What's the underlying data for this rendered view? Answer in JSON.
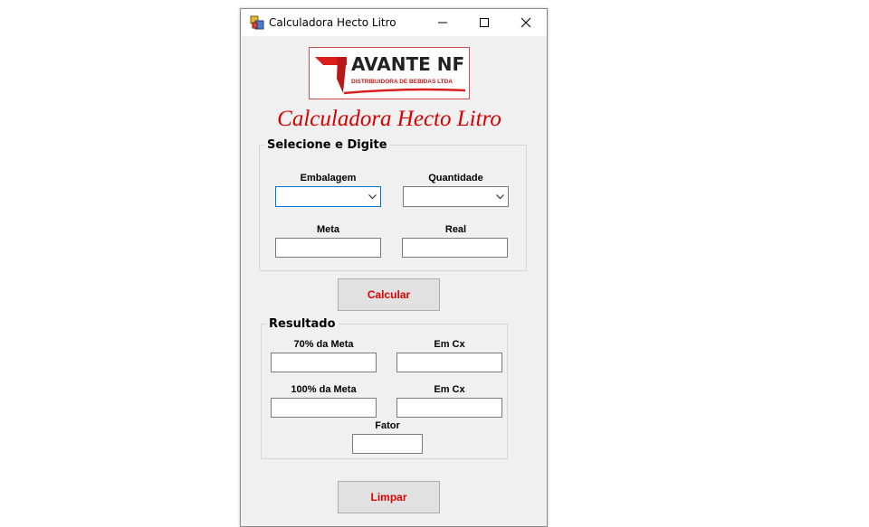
{
  "window": {
    "title": "Calculadora Hecto Litro",
    "icon": "app-window-icon",
    "controls": [
      "minimize-icon",
      "maximize-icon",
      "close-icon"
    ]
  },
  "logo": {
    "name": "AVANTE NF",
    "subtitle": "DISTRIBUIDORA DE BEBIDAS LTDA"
  },
  "heading": "Calculadora Hecto Litro",
  "input_group": {
    "legend": "Selecione e Digite",
    "embalagem_label": "Embalagem",
    "quantidade_label": "Quantidade",
    "meta_label": "Meta",
    "real_label": "Real"
  },
  "calcular_button": "Calcular",
  "result_group": {
    "legend": "Resultado",
    "meta70_label": "70% da Meta",
    "emcx1_label": "Em Cx",
    "meta100_label": "100% da Meta",
    "emcx2_label": "Em Cx",
    "fator_label": "Fator"
  },
  "limpar_button": "Limpar",
  "colors": {
    "accent_red": "#d80000",
    "button_text_red": "#e00000",
    "focus_blue": "#0078d7",
    "window_bg": "#f0f0f0"
  }
}
